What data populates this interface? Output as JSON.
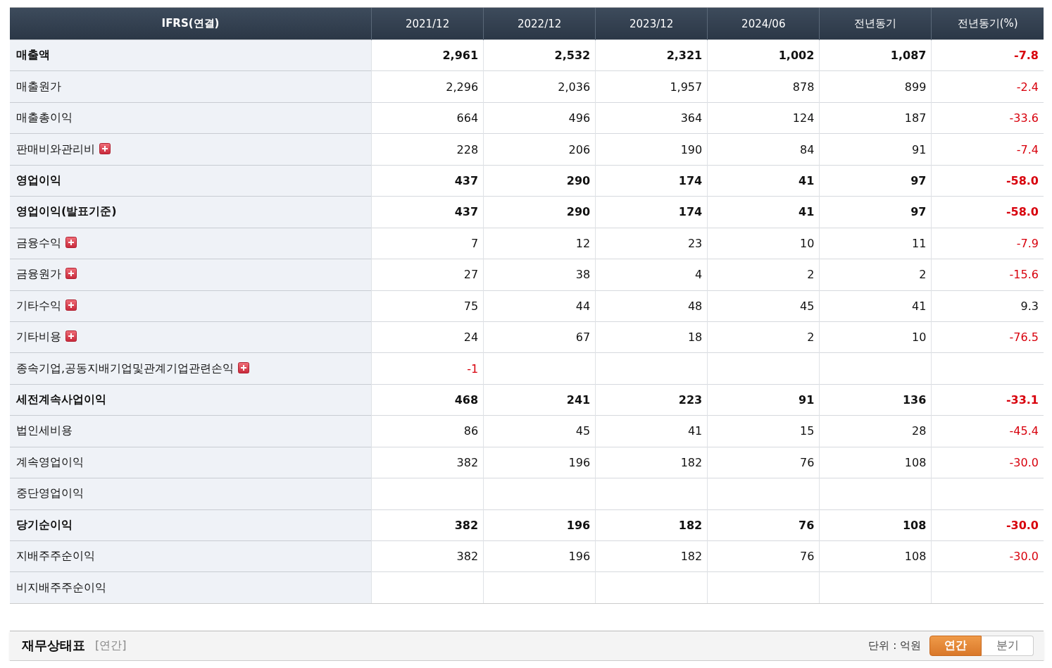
{
  "table": {
    "label_column": "IFRS(연결)",
    "columns": [
      "2021/12",
      "2022/12",
      "2023/12",
      "2024/06",
      "전년동기",
      "전년동기(%)"
    ],
    "rows": [
      {
        "label": "매출액",
        "bold": true,
        "expandable": false,
        "cells": [
          {
            "v": "2,961",
            "negative": false
          },
          {
            "v": "2,532",
            "negative": false
          },
          {
            "v": "2,321",
            "negative": false
          },
          {
            "v": "1,002",
            "negative": false
          },
          {
            "v": "1,087",
            "negative": false
          },
          {
            "v": "-7.8",
            "negative": true
          }
        ]
      },
      {
        "label": "매출원가",
        "bold": false,
        "expandable": false,
        "cells": [
          {
            "v": "2,296",
            "negative": false
          },
          {
            "v": "2,036",
            "negative": false
          },
          {
            "v": "1,957",
            "negative": false
          },
          {
            "v": "878",
            "negative": false
          },
          {
            "v": "899",
            "negative": false
          },
          {
            "v": "-2.4",
            "negative": true
          }
        ]
      },
      {
        "label": "매출총이익",
        "bold": false,
        "expandable": false,
        "cells": [
          {
            "v": "664",
            "negative": false
          },
          {
            "v": "496",
            "negative": false
          },
          {
            "v": "364",
            "negative": false
          },
          {
            "v": "124",
            "negative": false
          },
          {
            "v": "187",
            "negative": false
          },
          {
            "v": "-33.6",
            "negative": true
          }
        ]
      },
      {
        "label": "판매비와관리비",
        "bold": false,
        "expandable": true,
        "cells": [
          {
            "v": "228",
            "negative": false
          },
          {
            "v": "206",
            "negative": false
          },
          {
            "v": "190",
            "negative": false
          },
          {
            "v": "84",
            "negative": false
          },
          {
            "v": "91",
            "negative": false
          },
          {
            "v": "-7.4",
            "negative": true
          }
        ]
      },
      {
        "label": "영업이익",
        "bold": true,
        "expandable": false,
        "cells": [
          {
            "v": "437",
            "negative": false
          },
          {
            "v": "290",
            "negative": false
          },
          {
            "v": "174",
            "negative": false
          },
          {
            "v": "41",
            "negative": false
          },
          {
            "v": "97",
            "negative": false
          },
          {
            "v": "-58.0",
            "negative": true
          }
        ]
      },
      {
        "label": "영업이익(발표기준)",
        "bold": true,
        "expandable": false,
        "cells": [
          {
            "v": "437",
            "negative": false
          },
          {
            "v": "290",
            "negative": false
          },
          {
            "v": "174",
            "negative": false
          },
          {
            "v": "41",
            "negative": false
          },
          {
            "v": "97",
            "negative": false
          },
          {
            "v": "-58.0",
            "negative": true
          }
        ]
      },
      {
        "label": "금융수익",
        "bold": false,
        "expandable": true,
        "cells": [
          {
            "v": "7",
            "negative": false
          },
          {
            "v": "12",
            "negative": false
          },
          {
            "v": "23",
            "negative": false
          },
          {
            "v": "10",
            "negative": false
          },
          {
            "v": "11",
            "negative": false
          },
          {
            "v": "-7.9",
            "negative": true
          }
        ]
      },
      {
        "label": "금융원가",
        "bold": false,
        "expandable": true,
        "cells": [
          {
            "v": "27",
            "negative": false
          },
          {
            "v": "38",
            "negative": false
          },
          {
            "v": "4",
            "negative": false
          },
          {
            "v": "2",
            "negative": false
          },
          {
            "v": "2",
            "negative": false
          },
          {
            "v": "-15.6",
            "negative": true
          }
        ]
      },
      {
        "label": "기타수익",
        "bold": false,
        "expandable": true,
        "cells": [
          {
            "v": "75",
            "negative": false
          },
          {
            "v": "44",
            "negative": false
          },
          {
            "v": "48",
            "negative": false
          },
          {
            "v": "45",
            "negative": false
          },
          {
            "v": "41",
            "negative": false
          },
          {
            "v": "9.3",
            "negative": false
          }
        ]
      },
      {
        "label": "기타비용",
        "bold": false,
        "expandable": true,
        "cells": [
          {
            "v": "24",
            "negative": false
          },
          {
            "v": "67",
            "negative": false
          },
          {
            "v": "18",
            "negative": false
          },
          {
            "v": "2",
            "negative": false
          },
          {
            "v": "10",
            "negative": false
          },
          {
            "v": "-76.5",
            "negative": true
          }
        ]
      },
      {
        "label": "종속기업,공동지배기업및관계기업관련손익",
        "bold": false,
        "expandable": true,
        "cells": [
          {
            "v": "-1",
            "negative": true
          },
          null,
          null,
          null,
          null,
          null
        ]
      },
      {
        "label": "세전계속사업이익",
        "bold": true,
        "expandable": false,
        "cells": [
          {
            "v": "468",
            "negative": false
          },
          {
            "v": "241",
            "negative": false
          },
          {
            "v": "223",
            "negative": false
          },
          {
            "v": "91",
            "negative": false
          },
          {
            "v": "136",
            "negative": false
          },
          {
            "v": "-33.1",
            "negative": true
          }
        ]
      },
      {
        "label": "법인세비용",
        "bold": false,
        "expandable": false,
        "cells": [
          {
            "v": "86",
            "negative": false
          },
          {
            "v": "45",
            "negative": false
          },
          {
            "v": "41",
            "negative": false
          },
          {
            "v": "15",
            "negative": false
          },
          {
            "v": "28",
            "negative": false
          },
          {
            "v": "-45.4",
            "negative": true
          }
        ]
      },
      {
        "label": "계속영업이익",
        "bold": false,
        "expandable": false,
        "cells": [
          {
            "v": "382",
            "negative": false
          },
          {
            "v": "196",
            "negative": false
          },
          {
            "v": "182",
            "negative": false
          },
          {
            "v": "76",
            "negative": false
          },
          {
            "v": "108",
            "negative": false
          },
          {
            "v": "-30.0",
            "negative": true
          }
        ]
      },
      {
        "label": "중단영업이익",
        "bold": false,
        "expandable": false,
        "cells": [
          null,
          null,
          null,
          null,
          null,
          null
        ]
      },
      {
        "label": "당기순이익",
        "bold": true,
        "expandable": false,
        "cells": [
          {
            "v": "382",
            "negative": false
          },
          {
            "v": "196",
            "negative": false
          },
          {
            "v": "182",
            "negative": false
          },
          {
            "v": "76",
            "negative": false
          },
          {
            "v": "108",
            "negative": false
          },
          {
            "v": "-30.0",
            "negative": true
          }
        ],
        "children": [
          {
            "label": "지배주주순이익",
            "bold": false,
            "expandable": false,
            "cells": [
              {
                "v": "382",
                "negative": false
              },
              {
                "v": "196",
                "negative": false
              },
              {
                "v": "182",
                "negative": false
              },
              {
                "v": "76",
                "negative": false
              },
              {
                "v": "108",
                "negative": false
              },
              {
                "v": "-30.0",
                "negative": true
              }
            ]
          },
          {
            "label": "비지배주주순이익",
            "bold": false,
            "expandable": false,
            "cells": [
              null,
              null,
              null,
              null,
              null,
              null
            ]
          }
        ]
      }
    ]
  },
  "section": {
    "title": "재무상태표",
    "period": "[연간]",
    "unit": "단위 : 억원",
    "toggle": [
      {
        "label": "연간",
        "selected": true
      },
      {
        "label": "분기",
        "selected": false
      }
    ]
  }
}
